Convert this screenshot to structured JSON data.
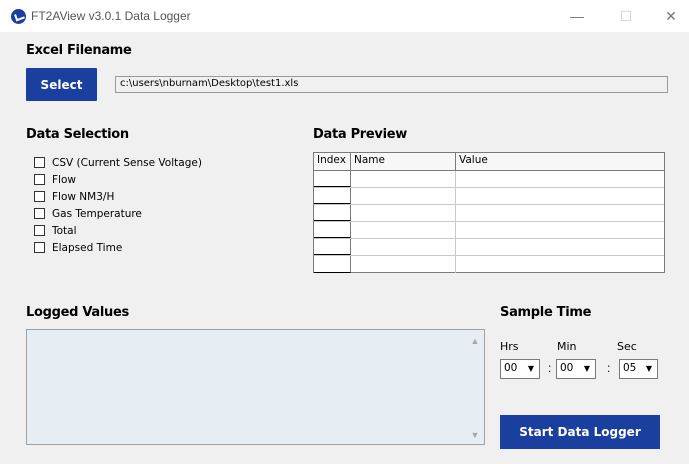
{
  "window": {
    "title": "FT2AView v3.0.1 Data Logger",
    "minimize": "—",
    "maximize": "☐",
    "close": "✕"
  },
  "excel": {
    "heading": "Excel Filename",
    "select_label": "Select",
    "filename": "c:\\users\\nburnam\\Desktop\\test1.xls"
  },
  "data_selection": {
    "heading": "Data Selection",
    "items": [
      {
        "label": "CSV (Current Sense Voltage)",
        "checked": false
      },
      {
        "label": "Flow",
        "checked": false
      },
      {
        "label": "Flow NM3/H",
        "checked": false
      },
      {
        "label": "Gas Temperature",
        "checked": false
      },
      {
        "label": "Total",
        "checked": false
      },
      {
        "label": "Elapsed Time",
        "checked": false
      }
    ]
  },
  "data_preview": {
    "heading": "Data Preview",
    "columns": [
      "Index",
      "Name",
      "Value"
    ],
    "row_count": 6
  },
  "logged_values": {
    "heading": "Logged Values",
    "content": ""
  },
  "sample_time": {
    "heading": "Sample Time",
    "hrs_label": "Hrs",
    "min_label": "Min",
    "sec_label": "Sec",
    "hrs_value": "00",
    "min_value": "00",
    "sec_value": "05",
    "separator": ":"
  },
  "start_label": "Start Data Logger",
  "colors": {
    "accent": "#1a3f9e",
    "background": "#f0f0f0",
    "log_area": "#e6eef4"
  }
}
